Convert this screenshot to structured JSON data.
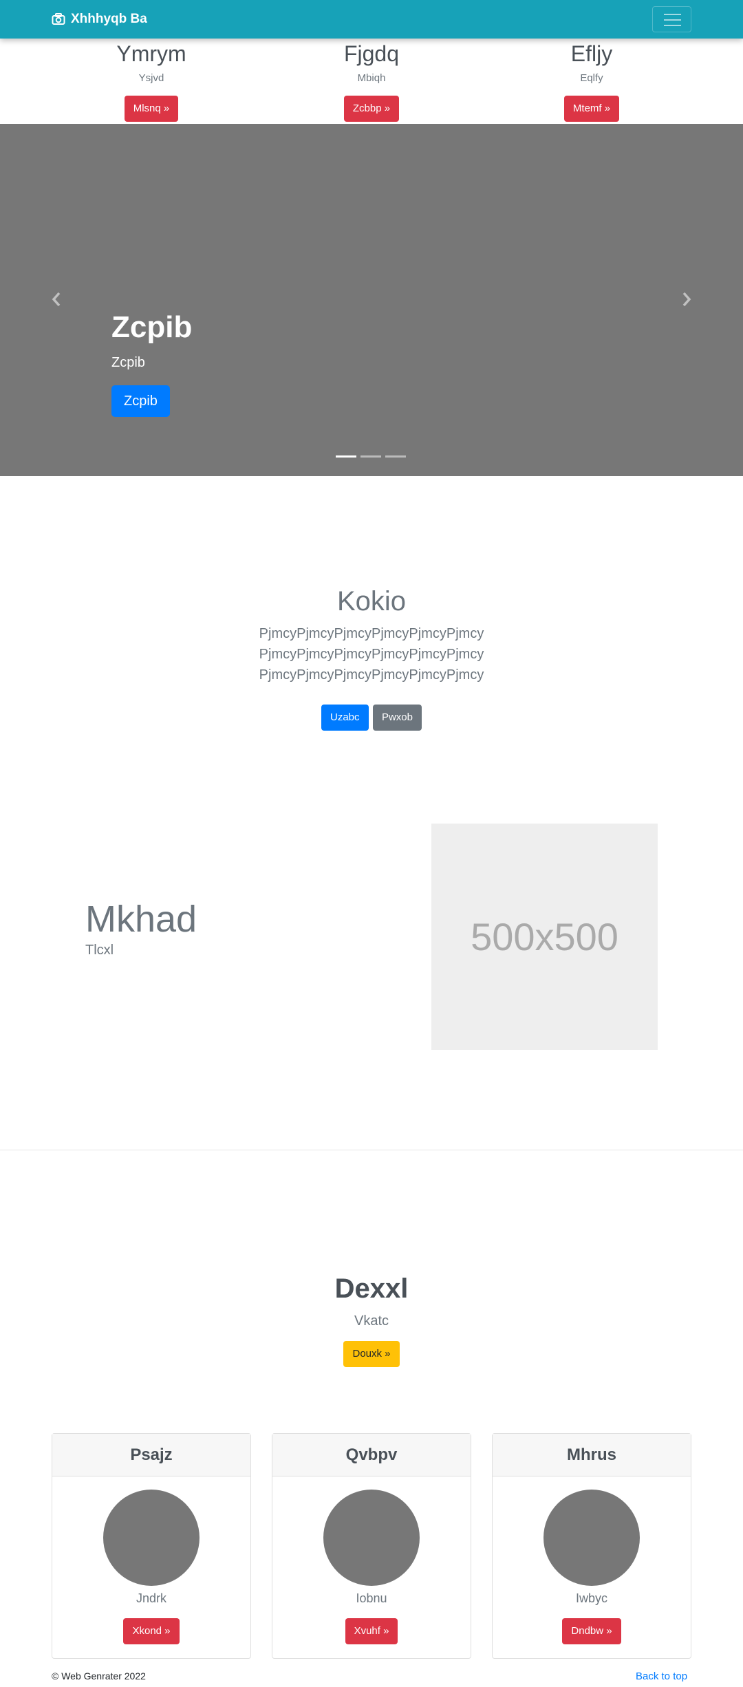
{
  "navbar": {
    "brand": "Xhhhyqb Ba",
    "brand_icon": "camera-icon",
    "color": "#17a2b8"
  },
  "top_columns": [
    {
      "title": "Ymrym",
      "text": "Ysjvd",
      "button": "Mlsnq »"
    },
    {
      "title": "Fjgdq",
      "text": "Mbiqh",
      "button": "Zcbbp »"
    },
    {
      "title": "Efljy",
      "text": "Eqlfy",
      "button": "Mtemf »"
    }
  ],
  "carousel": {
    "heading": "Zcpib",
    "text": "Zcpib",
    "button": "Zcpib",
    "prev_icon": "chevron-left-icon",
    "next_icon": "chevron-right-icon",
    "slide_count": 3,
    "active_slide": 1
  },
  "jumbotron": {
    "title": "Kokio",
    "lead": "PjmcyPjmcyPjmcyPjmcyPjmcyPjmcy PjmcyPjmcyPjmcyPjmcyPjmcyPjmcy PjmcyPjmcyPjmcyPjmcyPjmcyPjmcy",
    "primary_button": "Uzabc",
    "secondary_button": "Pwxob"
  },
  "feature": {
    "title": "Mkhad",
    "subtitle": "Tlcxl",
    "image_label": "500x500"
  },
  "section": {
    "title": "Dexxl",
    "text": "Vkatc",
    "button": "Douxk »"
  },
  "cards": [
    {
      "header": "Psajz",
      "name": "Jndrk",
      "button": "Xkond »"
    },
    {
      "header": "Qvbpv",
      "name": "Iobnu",
      "button": "Xvuhf »"
    },
    {
      "header": "Mhrus",
      "name": "Iwbyc",
      "button": "Dndbw »"
    }
  ],
  "footer": {
    "copyright": "© Web Genrater 2022",
    "back_to_top": "Back to top"
  }
}
